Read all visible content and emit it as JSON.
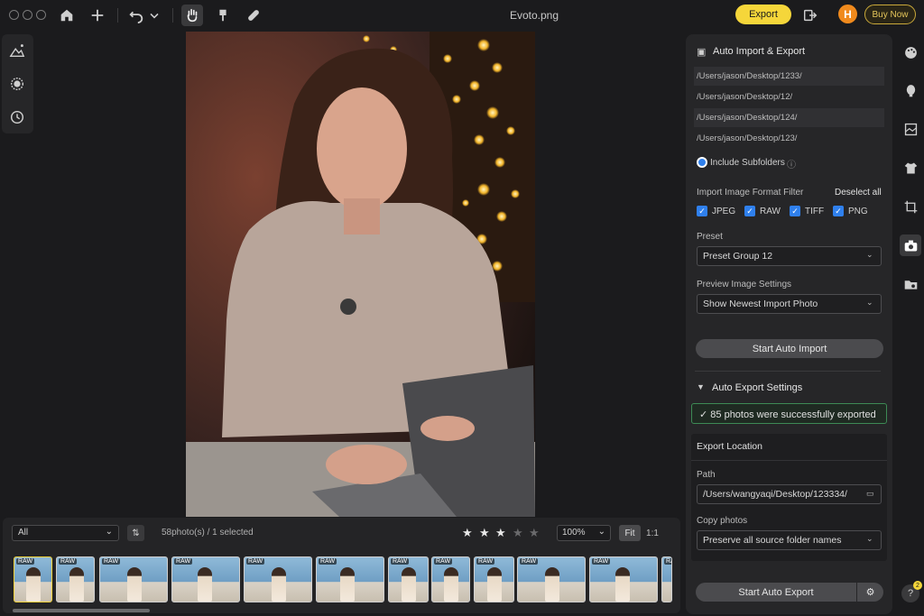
{
  "window": {
    "title": "Evoto.png"
  },
  "toolbar": {
    "export_label": "Export",
    "avatar_letter": "H",
    "buy_now_label": "Buy Now"
  },
  "filmstrip": {
    "filter_value": "All",
    "count_text": "58photo(s) / 1 selected",
    "rating": 3,
    "rating_max": 5,
    "zoom_value": "100%",
    "fit_label": "Fit",
    "one_to_one_label": "1:1",
    "thumb_badge": "RAW",
    "thumbs": 12
  },
  "panel": {
    "import_title": "Auto Import & Export",
    "folders": [
      "/Users/jason/Desktop/1233/",
      "/Users/jason/Desktop/12/",
      "/Users/jason/Desktop/124/",
      "/Users/jason/Desktop/123/"
    ],
    "include_subfolders": "Include Subfolders",
    "format_filter_label": "Import Image Format Filter",
    "deselect_all": "Deselect all",
    "formats": [
      "JPEG",
      "RAW",
      "TIFF",
      "PNG"
    ],
    "preset_label": "Preset",
    "preset_value": "Preset Group 12",
    "preview_label": "Preview Image Settings",
    "preview_value": "Show Newest Import Photo",
    "start_import": "Start Auto Import",
    "export_settings_title": "Auto Export Settings",
    "success_msg": "85 photos were successfully exported",
    "export_location": "Export Location",
    "path_label": "Path",
    "path_value": "/Users/wangyaqi/Desktop/123334/",
    "copy_photos_label": "Copy photos",
    "copy_photos_value": "Preserve all source folder names",
    "start_export": "Start Auto Export"
  },
  "help": {
    "badge": "2",
    "label": "?"
  },
  "colors": {
    "accent": "#f5d63a",
    "avatar": "#f08a1d",
    "checkbox": "#2f80ed",
    "success_border": "#3d8a55"
  }
}
